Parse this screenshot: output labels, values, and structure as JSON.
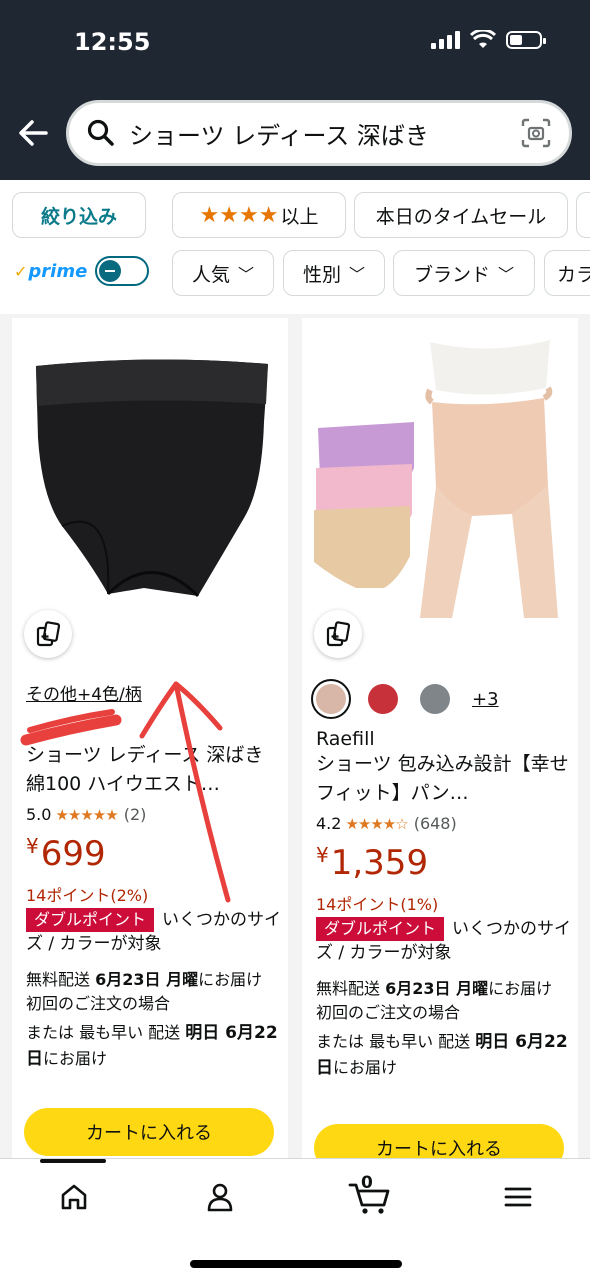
{
  "status": {
    "time": "12:55"
  },
  "search": {
    "query": "ショーツ レディース 深ばき"
  },
  "filters": {
    "refine_label": "絞り込み",
    "rating_label": "以上",
    "deals_label": "本日のタイムセール",
    "prime_label": "prime",
    "dropdowns": [
      "人気",
      "性別",
      "ブランド",
      "カラ"
    ]
  },
  "products": [
    {
      "variant_text": "その他+4色/柄",
      "title": "ショーツ レディース 深ばき 綿100 ハイウエスト…",
      "rating": "5.0",
      "stars": "★★★★★",
      "review_count": "(2)",
      "currency": "¥",
      "price": "699",
      "points": "14ポイント(2%)",
      "double_point": "ダブルポイント",
      "double_tail": "いくつかのサイズ / カラーが対象",
      "ship_line": "無料配送 6月23日 月曜にお届け 初回のご注文の場合",
      "ship_prefix": "無料配送 ",
      "ship_date": "6月23日 月曜",
      "ship_suffix": "にお届け 初回のご注文の場合",
      "fast_prefix": "または 最も早い 配送 ",
      "fast_date": "明日 6月22日",
      "fast_suffix": "にお届け",
      "cart_label": "カートに入れる"
    },
    {
      "swatch_colors": [
        "#d8b6a8",
        "#c7323a",
        "#7f8589"
      ],
      "more_colors": "+3",
      "brand": "Raefill",
      "title": "ショーツ 包み込み設計【幸せフィット】パン…",
      "rating": "4.2",
      "stars": "★★★★☆",
      "review_count": "(648)",
      "currency": "¥",
      "price": "1,359",
      "points": "14ポイント(1%)",
      "double_point": "ダブルポイント",
      "double_tail": "いくつかのサイズ / カラーが対象",
      "ship_prefix": "無料配送 ",
      "ship_date": "6月23日 月曜",
      "ship_suffix": "にお届け 初回のご注文の場合",
      "fast_prefix": "または 最も早い 配送 ",
      "fast_date": "明日 6月22日",
      "fast_suffix": "にお届け",
      "cart_label": "カートに入れる"
    }
  ],
  "nav": {
    "cart_count": "0"
  },
  "colors": {
    "accent_yellow": "#ffd814",
    "price_red": "#b12704",
    "annotation_red": "#e8403c",
    "topbar": "#1f2733"
  }
}
